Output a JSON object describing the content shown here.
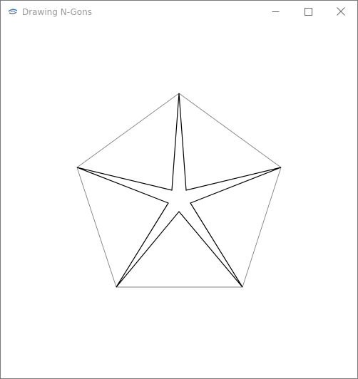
{
  "window": {
    "title": "Drawing N-Gons",
    "app_icon": "java-coffee-cup-icon",
    "controls": {
      "minimize_icon": "minimize-icon",
      "maximize_icon": "maximize-icon",
      "close_icon": "close-icon"
    }
  },
  "canvas": {
    "shapes": [
      "pentagon",
      "five-pointed-star"
    ],
    "pentagon_stroke": "#808080",
    "star_stroke": "#000000",
    "background": "#ffffff"
  }
}
